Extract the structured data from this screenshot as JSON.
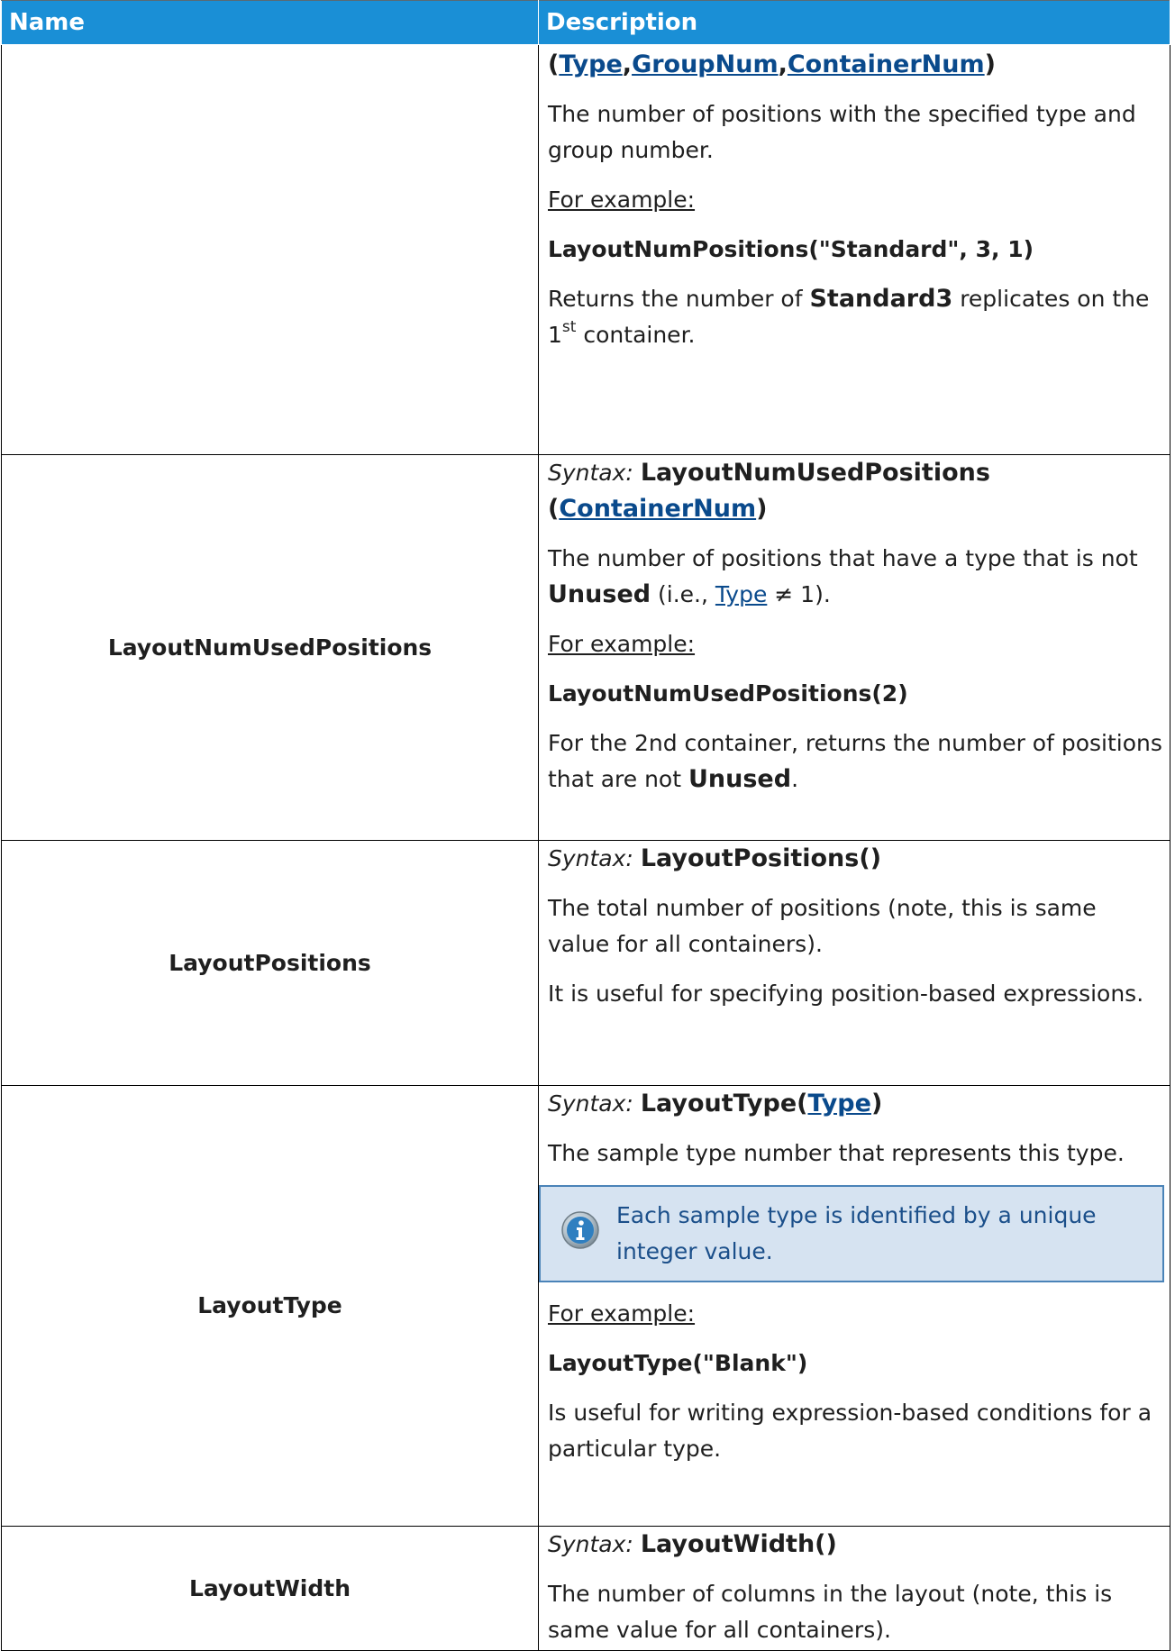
{
  "header": {
    "name": "Name",
    "description": "Description"
  },
  "rows": [
    {
      "name": "",
      "syntax_args": {
        "open": "(",
        "a1": "Type",
        "c1": ",",
        "a2": "GroupNum",
        "c2": ",",
        "a3": "ContainerNum",
        "close": ")"
      },
      "desc": "The number of positions with the specified type and group number.",
      "for_example": "For example:",
      "example": "LayoutNumPositions(\"Standard\", 3, 1)",
      "result": {
        "pre": "Returns the number of ",
        "bold": "Standard3",
        "mid": " replicates on the 1",
        "sup": "st",
        "post": " container."
      }
    },
    {
      "name": "LayoutNumUsedPositions",
      "syntax_label": "Syntax:",
      "syntax_fn": "LayoutNumUsedPositions",
      "syntax_open": "(",
      "syntax_link": "ContainerNum",
      "syntax_close": ")",
      "desc": {
        "pre": "The number of positions that have a type that is not ",
        "bold": "Unused",
        "mid": " (i.e., ",
        "link": "Type",
        "post": " ≠ 1)."
      },
      "for_example": "For example:",
      "example": "LayoutNumUsedPositions(2)",
      "result": {
        "pre": "For the 2nd container, returns the number of positions that are not ",
        "bold": "Unused",
        "post": "."
      }
    },
    {
      "name": "LayoutPositions",
      "syntax_label": "Syntax:",
      "syntax_fn": "LayoutPositions()",
      "desc": "The total number of positions (note, this is same value for all containers).",
      "desc2": "It is useful for specifying position-based expressions."
    },
    {
      "name": "LayoutType",
      "syntax_label": "Syntax:",
      "syntax_fn": "LayoutType(",
      "syntax_link": "Type",
      "syntax_close": ")",
      "desc": "The sample type number that represents this type.",
      "note": "Each sample type is identified by a unique integer value.",
      "for_example": "For example:",
      "example": "LayoutType(\"Blank\")",
      "result": "Is useful for writing expression-based conditions for a particular type."
    },
    {
      "name": "LayoutWidth",
      "syntax_label": "Syntax:",
      "syntax_fn": "LayoutWidth()",
      "desc": "The number of columns in the layout (note, this is same value for all containers)."
    }
  ],
  "icons": {
    "note": "info-icon"
  },
  "colors": {
    "header_bg": "#1a8fd6",
    "link": "#0a4a8c",
    "note_bg": "#d6e3f1",
    "note_border": "#4a83b8",
    "note_text": "#1b4f8a"
  }
}
